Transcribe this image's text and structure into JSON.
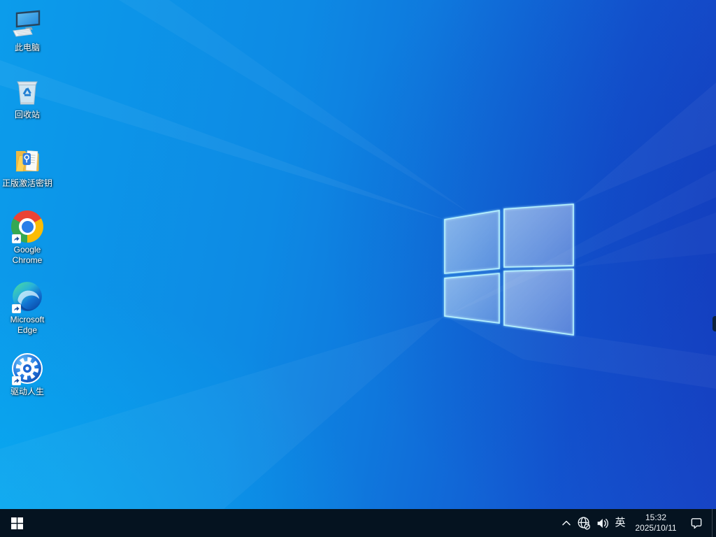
{
  "desktop": {
    "icons": [
      {
        "label": "此电脑",
        "icon": "this-pc-icon",
        "shortcut_overlay": false
      },
      {
        "label": "回收站",
        "icon": "recycle-bin-icon",
        "shortcut_overlay": false
      },
      {
        "label": "正版激活密钥",
        "icon": "activation-key-folder-icon",
        "shortcut_overlay": false
      },
      {
        "label": "Google Chrome",
        "icon": "google-chrome-icon",
        "shortcut_overlay": true
      },
      {
        "label": "Microsoft Edge",
        "icon": "microsoft-edge-icon",
        "shortcut_overlay": true
      },
      {
        "label": "驱动人生",
        "icon": "driver-life-gear-icon",
        "shortcut_overlay": true
      }
    ]
  },
  "taskbar": {
    "start": {
      "icon": "windows-start-icon"
    },
    "tray": {
      "hidden_icons_icon": "chevron-up-icon",
      "network_icon": "globe-no-internet-icon",
      "volume_icon": "speaker-icon",
      "ime_indicator": "英",
      "clock": {
        "time": "15:32",
        "date": "2025/10/11"
      },
      "action_center_icon": "action-center-icon"
    }
  },
  "colors": {
    "wallpaper_bright": "#0aa7ef",
    "wallpaper_mid": "#0d86e4",
    "wallpaper_deep": "#1847c8",
    "logo_glow": "#aef2ff",
    "taskbar_background": "#051320",
    "taskbar_foreground": "#eef3f7"
  }
}
